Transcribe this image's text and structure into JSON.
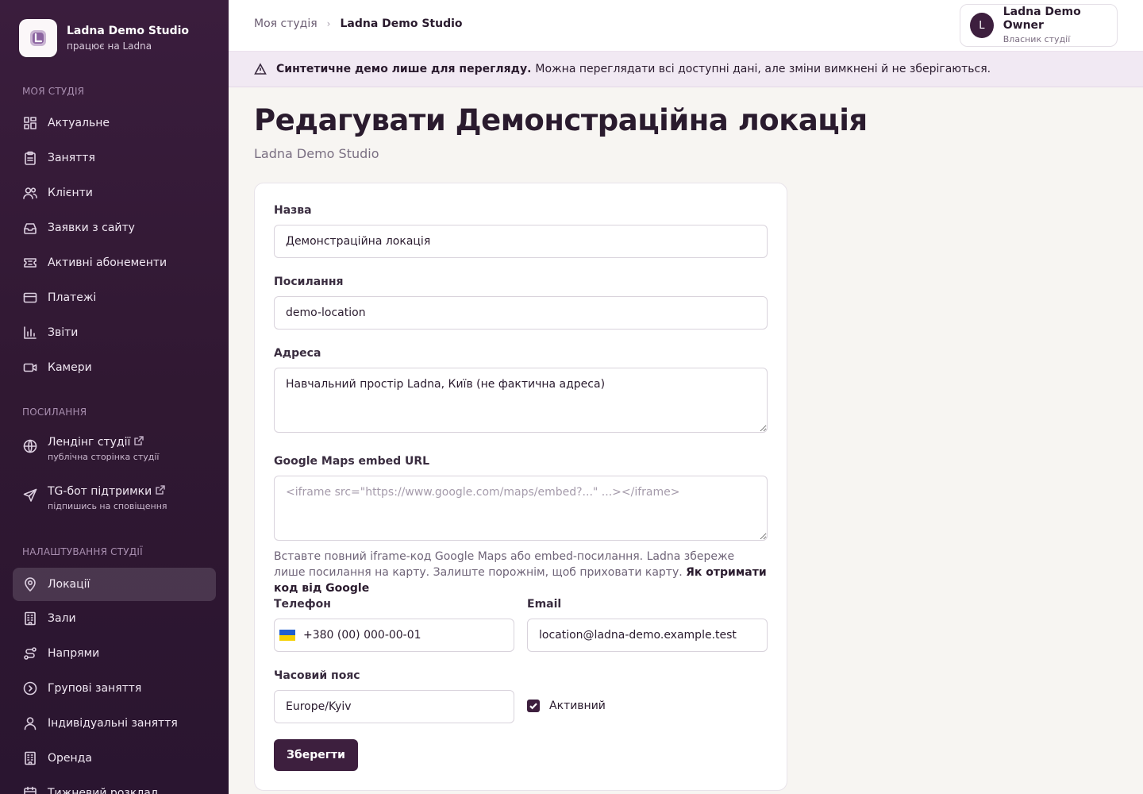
{
  "brand": {
    "name": "Ladna Demo Studio",
    "sub": "працює на Ladna"
  },
  "sidebar": {
    "section_studio": "Моя студія",
    "studio_items": [
      {
        "label": "Актуальне",
        "icon": "dashboard-icon"
      },
      {
        "label": "Заняття",
        "icon": "clipboard-icon"
      },
      {
        "label": "Клієнти",
        "icon": "users-icon"
      },
      {
        "label": "Заявки з сайту",
        "icon": "inbox-icon"
      },
      {
        "label": "Активні абонементи",
        "icon": "ticket-icon"
      },
      {
        "label": "Платежі",
        "icon": "credit-card-icon"
      },
      {
        "label": "Звіти",
        "icon": "bar-chart-icon"
      },
      {
        "label": "Камери",
        "icon": "video-icon"
      }
    ],
    "section_links": "Посилання",
    "link_items": [
      {
        "label": "Лендінг студії",
        "sub": "публічна сторінка студії",
        "icon": "globe-icon"
      },
      {
        "label": "TG-бот підтримки",
        "sub": "підпишись на сповіщення",
        "icon": "send-icon"
      }
    ],
    "section_settings": "Налаштування студії",
    "settings_items": [
      {
        "label": "Локації",
        "icon": "map-pin-icon",
        "active": true
      },
      {
        "label": "Зали",
        "icon": "building-icon"
      },
      {
        "label": "Напрями",
        "icon": "route-icon"
      },
      {
        "label": "Групові заняття",
        "icon": "clock-icon"
      },
      {
        "label": "Індивідуальні заняття",
        "icon": "user-icon"
      },
      {
        "label": "Оренда",
        "icon": "building-icon"
      },
      {
        "label": "Тижневий розклад",
        "icon": "calendar-icon"
      }
    ]
  },
  "breadcrumb": {
    "parent": "Моя студія",
    "current": "Ladna Demo Studio"
  },
  "user": {
    "initial": "L",
    "name": "Ladna Demo Owner",
    "role": "Власник студії"
  },
  "banner": {
    "bold": "Синтетичне демо лише для перегляду.",
    "text": "Можна переглядати всі доступні дані, але зміни вимкнені й не зберігаються."
  },
  "page": {
    "title": "Редагувати Демонстраційна локація",
    "subtitle": "Ladna Demo Studio"
  },
  "form": {
    "name_label": "Назва",
    "name_value": "Демонстраційна локація",
    "slug_label": "Посилання",
    "slug_value": "demo-location",
    "address_label": "Адреса",
    "address_value": "Навчальний простір Ladna, Київ (не фактична адреса)",
    "maps_label": "Google Maps embed URL",
    "maps_placeholder": "<iframe src=\"https://www.google.com/maps/embed?...\" ...></iframe>",
    "maps_hint": "Вставте повний iframe-код Google Maps або embed-посилання. Ladna збереже лише посилання на карту. Залиште порожнім, щоб приховати карту.",
    "maps_hint_link": "Як отримати код від Google",
    "phone_label": "Телефон",
    "phone_value": "+380 (00) 000-00-01",
    "email_label": "Email",
    "email_value": "location@ladna-demo.example.test",
    "tz_label": "Часовий пояс",
    "tz_value": "Europe/Kyiv",
    "active_label": "Активний",
    "active_checked": true,
    "save_label": "Зберегти"
  },
  "colors": {
    "sidebar": "#3a1d3d",
    "accent": "#3d1f3e",
    "banner": "#f1e9f3",
    "flag_blue": "#1f5fd0",
    "flag_yellow": "#f5d000"
  }
}
